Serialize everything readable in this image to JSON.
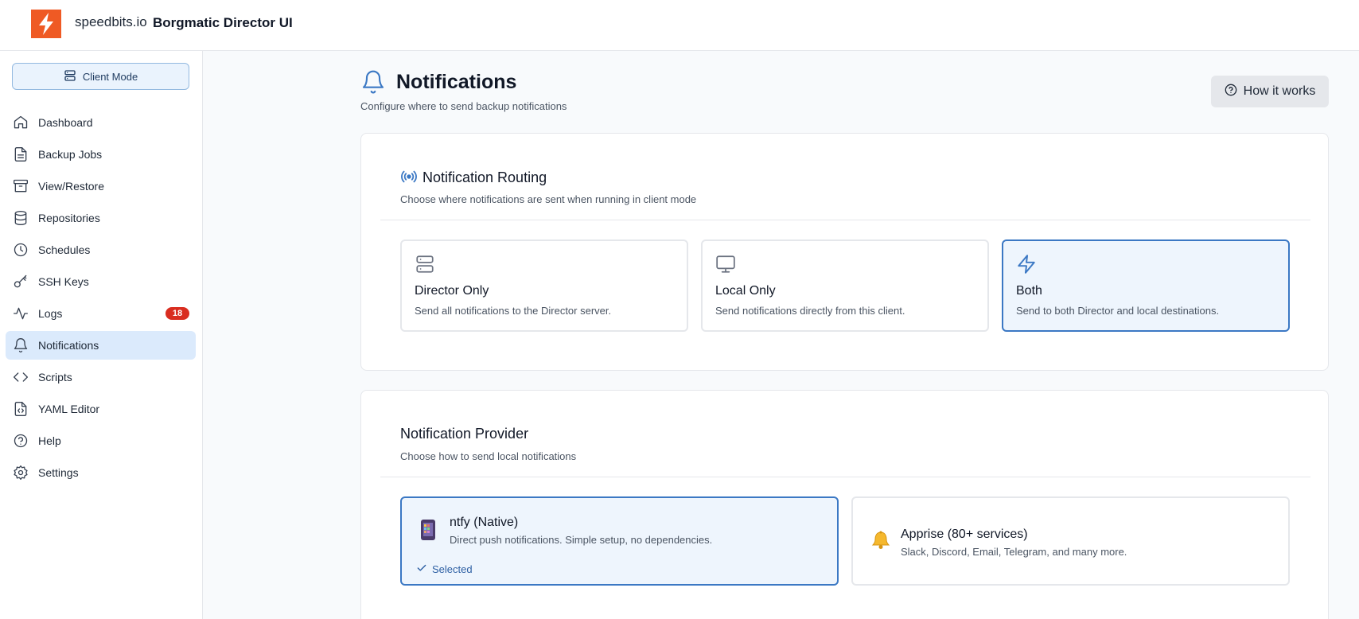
{
  "header": {
    "brand": "speedbits.io",
    "app_title": "Borgmatic Director UI",
    "logo_icon": "lightning-bolt-icon",
    "logo_color": "#ef5a24"
  },
  "sidebar": {
    "mode_button": "Client Mode",
    "items": [
      {
        "label": "Dashboard",
        "icon": "home-icon"
      },
      {
        "label": "Backup Jobs",
        "icon": "file-icon"
      },
      {
        "label": "View/Restore",
        "icon": "archive-icon"
      },
      {
        "label": "Repositories",
        "icon": "database-icon"
      },
      {
        "label": "Schedules",
        "icon": "clock-icon"
      },
      {
        "label": "SSH Keys",
        "icon": "key-icon"
      },
      {
        "label": "Logs",
        "icon": "activity-icon",
        "badge": "18"
      },
      {
        "label": "Notifications",
        "icon": "bell-icon",
        "active": true
      },
      {
        "label": "Scripts",
        "icon": "code-icon"
      },
      {
        "label": "YAML Editor",
        "icon": "file-code-icon"
      },
      {
        "label": "Help",
        "icon": "help-circle-icon"
      },
      {
        "label": "Settings",
        "icon": "gear-icon"
      }
    ]
  },
  "page": {
    "title": "Notifications",
    "subtitle": "Configure where to send backup notifications",
    "how_it_works": "How it works"
  },
  "routing": {
    "title": "Notification Routing",
    "subtitle": "Choose where notifications are sent when running in client mode",
    "options": [
      {
        "title": "Director Only",
        "desc": "Send all notifications to the Director server.",
        "icon": "server-icon",
        "selected": false
      },
      {
        "title": "Local Only",
        "desc": "Send notifications directly from this client.",
        "icon": "monitor-icon",
        "selected": false
      },
      {
        "title": "Both",
        "desc": "Send to both Director and local destinations.",
        "icon": "zap-icon",
        "selected": true
      }
    ]
  },
  "provider": {
    "title": "Notification Provider",
    "subtitle": "Choose how to send local notifications",
    "options": [
      {
        "title": "ntfy (Native)",
        "desc": "Direct push notifications. Simple setup, no dependencies.",
        "icon": "mobile-phone-icon",
        "selected": true,
        "selected_label": "Selected"
      },
      {
        "title": "Apprise (80+ services)",
        "desc": "Slack, Discord, Email, Telegram, and many more.",
        "icon": "bell-emoji-icon",
        "selected": false
      }
    ]
  },
  "colors": {
    "accent": "#3b78c4",
    "active_nav": "#dbeafc",
    "badge": "#d92d20"
  }
}
